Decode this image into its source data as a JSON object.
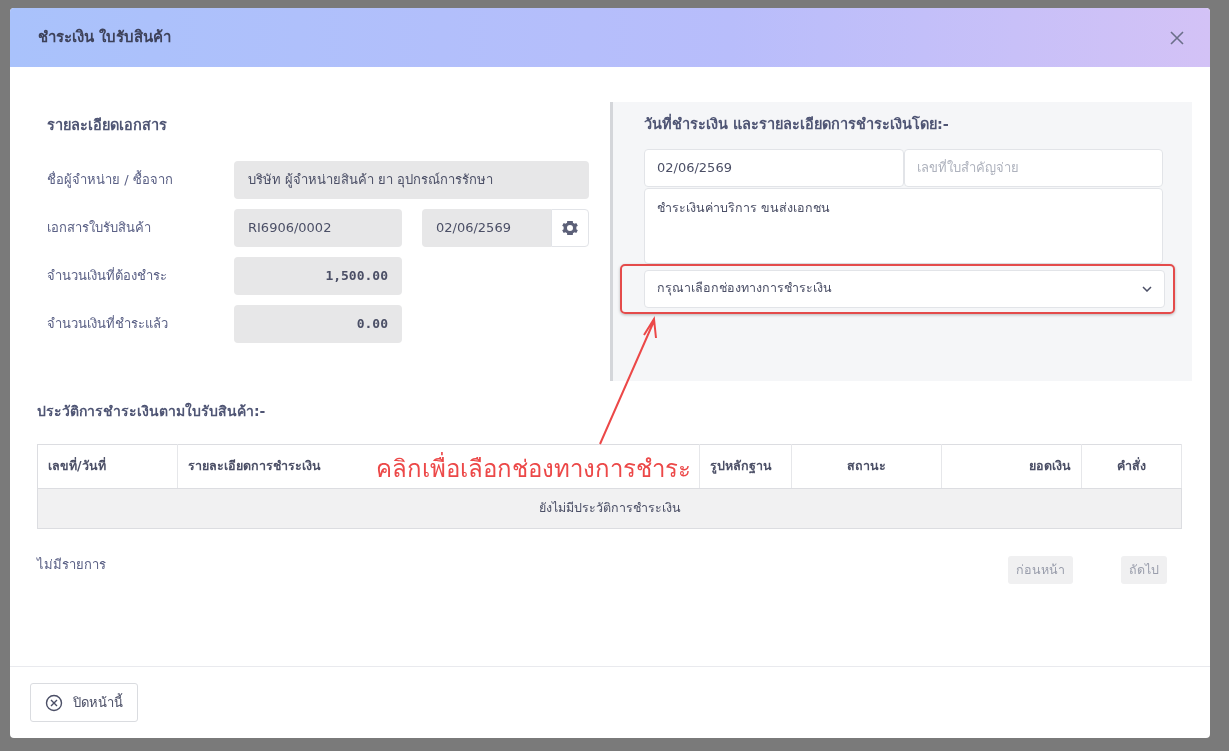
{
  "modal": {
    "title": "ชำระเงิน ใบรับสินค้า"
  },
  "document_details": {
    "heading": "รายละเอียดเอกสาร",
    "fields": [
      {
        "label": "ชื่อผู้จำหน่าย / ซื้อจาก",
        "kind": "wide",
        "value": "บริษัท ผู้จำหน่ายสินค้า ยา อุปกรณ์การรักษา"
      },
      {
        "label": "เอกสารใบรับสินค้า",
        "kind": "doc",
        "value": "RI6906/0002",
        "date": "02/06/2569"
      },
      {
        "label": "จำนวนเงินที่ต้องชำระ",
        "kind": "amount",
        "value": "1,500.00"
      },
      {
        "label": "จำนวนเงินที่ชำระแล้ว",
        "kind": "amount",
        "value": "0.00"
      }
    ]
  },
  "payment": {
    "heading": "วันที่ชำระเงิน และรายละเอียดการชำระเงินโดย:-",
    "date": "02/06/2569",
    "reference_placeholder": "เลขที่ใบสำคัญจ่าย",
    "note": "ชำระเงินค่าบริการ ขนส่งเอกชน",
    "channel_placeholder": "กรุณาเลือกช่องทางการชำระเงิน"
  },
  "annotation": {
    "text": "คลิกเพื่อเลือกช่องทางการชำระ"
  },
  "history": {
    "heading": "ประวัติการชำระเงินตามใบรับสินค้า:-",
    "columns": [
      "เลขที่/วันที่",
      "รายละเอียดการชำระเงิน",
      "รูปหลักฐาน",
      "สถานะ",
      "ยอดเงิน",
      "คำสั่ง"
    ],
    "empty_message": "ยังไม่มีประวัติการชำระเงิน",
    "count_text": "ไม่มีรายการ",
    "pager": [
      {
        "label": "ก่อนหน้า",
        "disabled": true
      },
      {
        "label": "ถัดไป",
        "disabled": true
      }
    ]
  },
  "footer": {
    "close_button": "ปิดหน้านี้"
  }
}
